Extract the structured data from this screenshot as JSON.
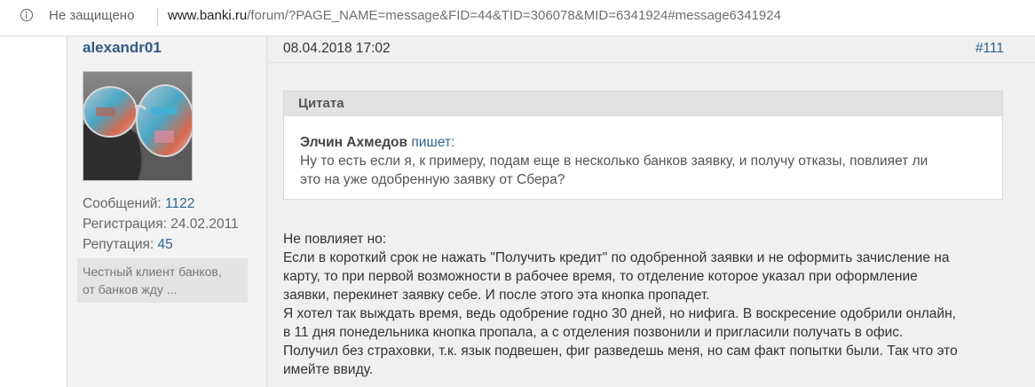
{
  "browser": {
    "security_label": "Не защищено",
    "url_domain": "www.banki.ru",
    "url_path": "/forum/?PAGE_NAME=message&FID=44&TID=306078&MID=6341924#message6341924"
  },
  "post": {
    "author": {
      "username": "alexandr01",
      "messages_label": "Сообщений:",
      "messages_value": "1122",
      "registration_label": "Регистрация:",
      "registration_value": "24.02.2011",
      "reputation_label": "Репутация:",
      "reputation_value": "45",
      "status_line1": "Честный клиент банков,",
      "status_line2": "от банков жду ..."
    },
    "date": "08.04.2018 17:02",
    "number": "#111",
    "quote": {
      "header": "Цитата",
      "author": "Элчин Ахмедов",
      "writes": "пишет:",
      "line1": "Ну то есть если я, к примеру, подам еще в несколько банков заявку, и получу отказы, повлияет ли",
      "line2": "это на уже одобренную заявку от Сбера?"
    },
    "body": [
      "Не повлияет но:",
      "Если в короткий срок не нажать \"Получить кредит\" по одобренной заявки и не оформить зачисление на",
      "карту, то при первой возможности в рабочее время, то отделение которое указал при оформление",
      "заявки, перекинет заявку себе. И после этого эта кнопка пропадет.",
      "Я хотел так выждать время, ведь одобрение годно 30 дней, но нифига. В воскресение одобрили онлайн,",
      "в 11 дня понедельника кнопка пропала, а с отделения позвонили и пригласили получать в офис.",
      "Получил без страховки, т.к. язык подвешен, фиг разведешь меня, но сам факт попытки были. Так что это",
      "имейте ввиду."
    ]
  }
}
